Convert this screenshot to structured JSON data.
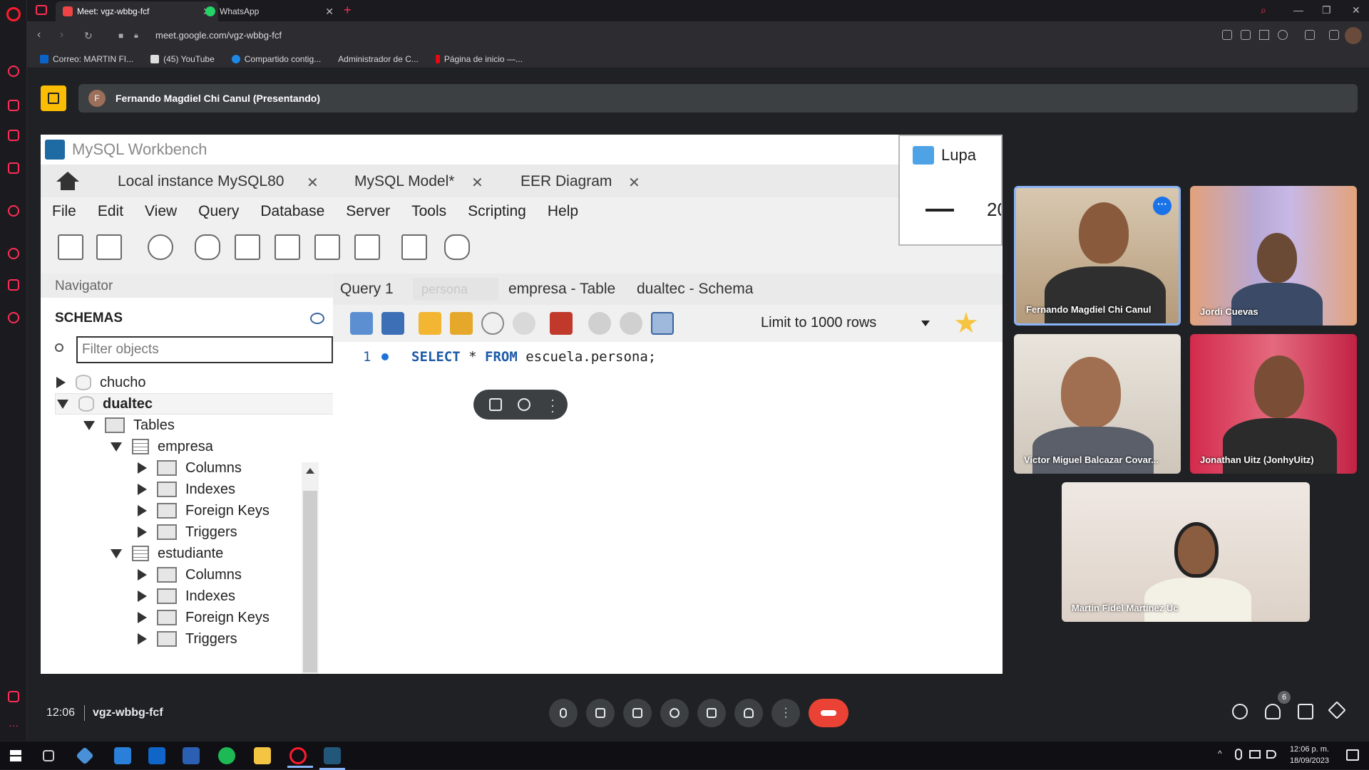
{
  "browser": {
    "tabs": [
      {
        "title": "Meet: vgz-wbbg-fcf",
        "active": true
      },
      {
        "title": "WhatsApp",
        "active": false
      }
    ],
    "url": "meet.google.com/vgz-wbbg-fcf",
    "bookmarks": [
      "Correo: MARTIN FI...",
      "(45) YouTube",
      "Compartido contig...",
      "Administrador de C...",
      "Página de inicio —..."
    ]
  },
  "meet": {
    "presenter_initial": "F",
    "presenter_label": "Fernando Magdiel Chi Canul (Presentando)",
    "time": "12:06",
    "meeting_code": "vgz-wbbg-fcf",
    "participant_count": "6",
    "participants": [
      {
        "name": "Fernando Magdiel Chi Canul"
      },
      {
        "name": "Jordi Cuevas"
      },
      {
        "name": "Victor Miguel Balcazar Covar..."
      },
      {
        "name": "Jonathan Uitz (JonhyUitz)"
      },
      {
        "name": "Martin Fidel Martinez Uc"
      }
    ]
  },
  "workbench": {
    "title": "MySQL Workbench",
    "tabs": [
      "Local instance MySQL80",
      "MySQL Model*",
      "EER Diagram"
    ],
    "menu": [
      "File",
      "Edit",
      "View",
      "Query",
      "Database",
      "Server",
      "Tools",
      "Scripting",
      "Help"
    ],
    "navigator": {
      "header": "Navigator",
      "schemas_label": "SCHEMAS",
      "filter_placeholder": "Filter objects",
      "tree": {
        "schema1": "chucho",
        "schema2": "dualtec",
        "tables": "Tables",
        "table1": "empresa",
        "table2": "estudiante",
        "columns": "Columns",
        "indexes": "Indexes",
        "foreign_keys": "Foreign Keys",
        "triggers": "Triggers"
      }
    },
    "query_tabs": [
      "Query 1",
      "persona",
      "empresa - Table",
      "dualtec - Schema"
    ],
    "limit_label": "Limit to 1000 rows",
    "editor": {
      "line_number": "1",
      "keyword_select": "SELECT",
      "star": "*",
      "keyword_from": "FROM",
      "target": "escuela.persona;"
    }
  },
  "lupa": {
    "title": "Lupa",
    "zoom_partial": "20"
  },
  "system": {
    "time": "12:06 p. m.",
    "date": "18/09/2023"
  }
}
